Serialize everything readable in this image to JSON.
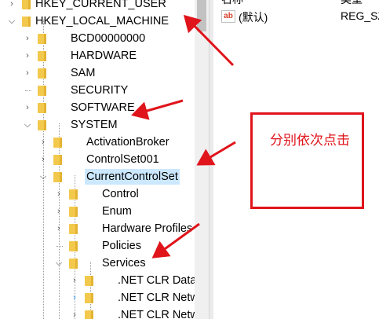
{
  "tree": {
    "items": [
      {
        "label": "HKEY_CURRENT_USER",
        "depth": 0,
        "state": "collapsed",
        "partial": true
      },
      {
        "label": "HKEY_LOCAL_MACHINE",
        "depth": 0,
        "state": "expanded"
      },
      {
        "label": "BCD00000000",
        "depth": 1,
        "state": "collapsed"
      },
      {
        "label": "HARDWARE",
        "depth": 1,
        "state": "collapsed"
      },
      {
        "label": "SAM",
        "depth": 1,
        "state": "collapsed"
      },
      {
        "label": "SECURITY",
        "depth": 1,
        "state": "leaf"
      },
      {
        "label": "SOFTWARE",
        "depth": 1,
        "state": "collapsed"
      },
      {
        "label": "SYSTEM",
        "depth": 1,
        "state": "expanded"
      },
      {
        "label": "ActivationBroker",
        "depth": 2,
        "state": "collapsed"
      },
      {
        "label": "ControlSet001",
        "depth": 2,
        "state": "collapsed"
      },
      {
        "label": "CurrentControlSet",
        "depth": 2,
        "state": "expanded",
        "selected": true
      },
      {
        "label": "Control",
        "depth": 3,
        "state": "collapsed"
      },
      {
        "label": "Enum",
        "depth": 3,
        "state": "collapsed"
      },
      {
        "label": "Hardware Profiles",
        "depth": 3,
        "state": "collapsed"
      },
      {
        "label": "Policies",
        "depth": 3,
        "state": "leaf"
      },
      {
        "label": "Services",
        "depth": 3,
        "state": "expanded"
      },
      {
        "label": ".NET CLR Data",
        "depth": 4,
        "state": "collapsed"
      },
      {
        "label": ".NET CLR Networking",
        "depth": 4,
        "state": "collapsed",
        "hover": true
      },
      {
        "label": ".NET CLR Networking",
        "depth": 4,
        "state": "collapsed"
      }
    ]
  },
  "right_pane": {
    "header_name": "名称",
    "header_type": "类型",
    "rows": [
      {
        "name": "(默认)",
        "type": "REG_SZ",
        "icon": "string-value-icon"
      }
    ]
  },
  "annotation": {
    "text": "分别依次点击",
    "color": "#e0141b"
  }
}
